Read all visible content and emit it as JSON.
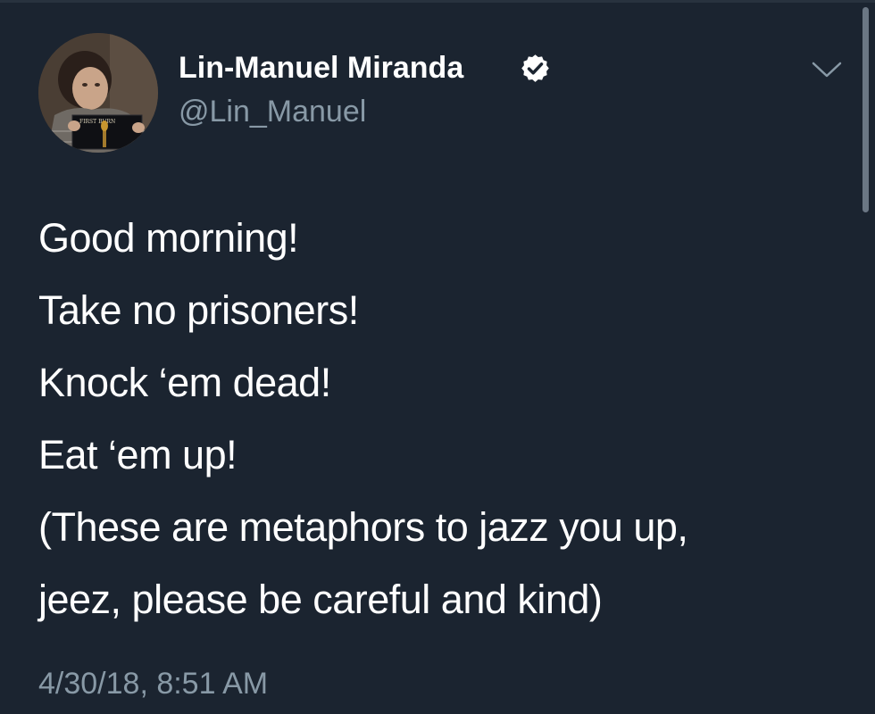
{
  "tweet": {
    "author": {
      "display_name": "Lin-Manuel Miranda",
      "handle": "@Lin_Manuel",
      "verified": true,
      "verified_icon": "verified-badge-icon",
      "avatar_book_title": "FIRST BURN"
    },
    "menu_icon": "chevron-down-icon",
    "lines": [
      "Good morning!",
      "Take no prisoners!",
      "Knock ‘em dead!",
      "Eat ‘em up!",
      "(These are metaphors to jazz you up,",
      "jeez, please be careful and kind)"
    ],
    "timestamp": "4/30/18, 8:51 AM"
  },
  "colors": {
    "background": "#1b2430",
    "text_primary": "#ffffff",
    "text_secondary": "#8899a6"
  }
}
